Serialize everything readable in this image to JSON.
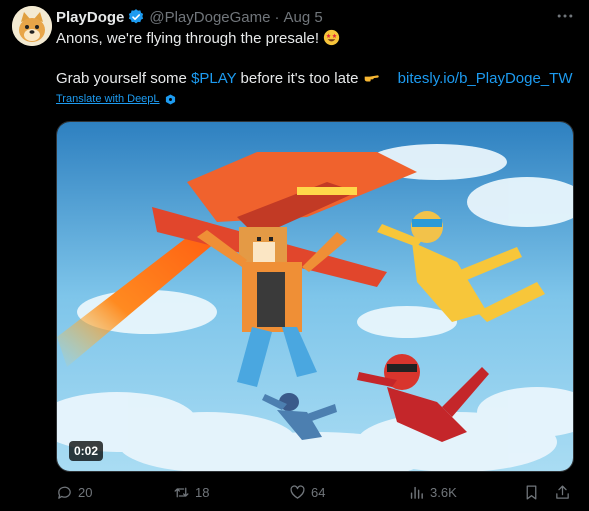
{
  "author": {
    "name": "PlayDoge",
    "handle": "@PlayDogeGame",
    "separator": "·",
    "date": "Aug 5"
  },
  "tweet": {
    "line1": "Anons, we're flying through the presale!",
    "line2_pre": "Grab yourself some ",
    "cashtag": "$PLAY",
    "line2_post": " before it's too late",
    "link": "bitesly.io/b_PlayDoge_TW",
    "translate": "Translate with DeepL"
  },
  "media": {
    "duration": "0:02"
  },
  "actions": {
    "replies": "20",
    "reposts": "18",
    "likes": "64",
    "views": "3.6K"
  },
  "icons": [
    "more-icon",
    "verified-icon",
    "star-struck-emoji-icon",
    "pointing-emoji-icon",
    "deepl-icon",
    "reply-icon",
    "repost-icon",
    "like-icon",
    "views-icon",
    "bookmark-icon",
    "share-icon"
  ],
  "colors": {
    "accent": "#1d9bf0",
    "muted": "#71767b",
    "text": "#e7e9ea",
    "background": "#000000"
  }
}
